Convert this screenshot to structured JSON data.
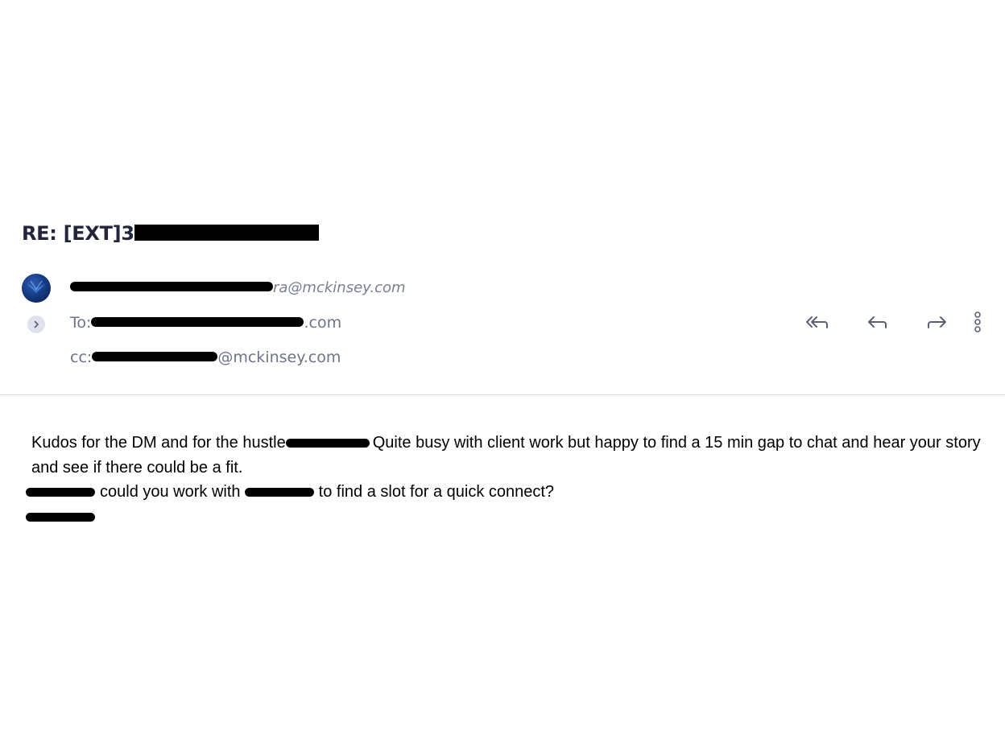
{
  "email": {
    "subject_prefix": "RE: [EXT]3",
    "from": {
      "email_suffix": "ra@mckinsey.com"
    },
    "to": {
      "label": "To:",
      "email_suffix": ".com"
    },
    "cc": {
      "label": "cc:",
      "email_suffix": "@mckinsey.com"
    }
  },
  "actions": {
    "reply_all_icon": "reply-all-icon",
    "reply_icon": "reply-icon",
    "forward_icon": "forward-icon",
    "more_icon": "more-vertical-icon"
  },
  "body": {
    "p1_a": "Kudos for the DM and for the hustle",
    "p1_b": "Quite busy with client work but happy to find a 15 min gap to chat and hear your story and see if there could be a fit.",
    "p2_a": "could you work with",
    "p2_b": "to find a slot for a quick connect?"
  },
  "colors": {
    "subject": "#23263a",
    "meta_text": "#6f7388",
    "divider": "#d9dbe2",
    "expand_bg": "#dfe1ee",
    "icon": "#5b5f72"
  }
}
